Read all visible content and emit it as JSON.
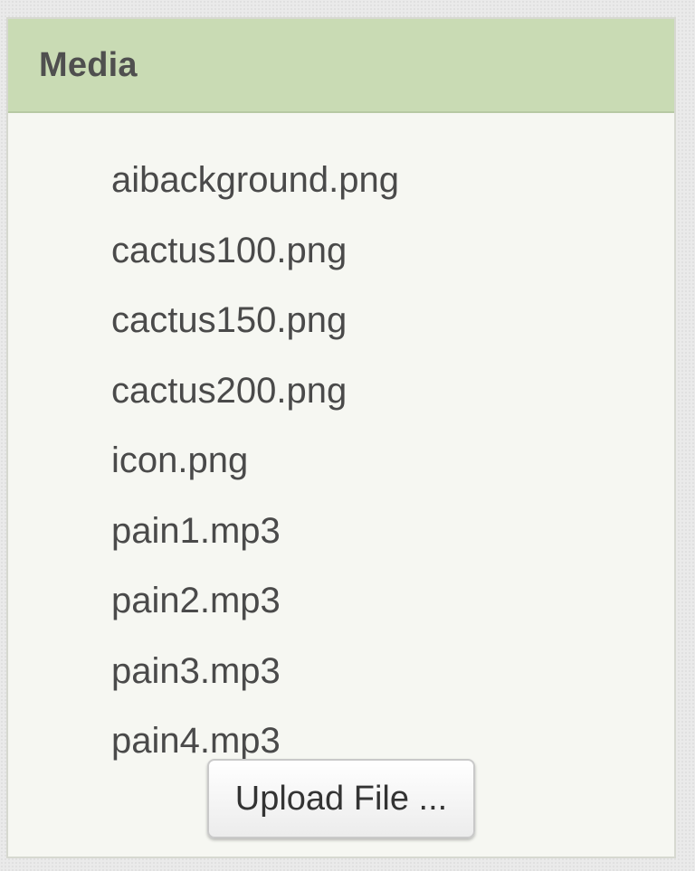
{
  "panel": {
    "title": "Media",
    "colors": {
      "header_bg": "#c9dbb4",
      "body_bg": "#f6f7f2"
    }
  },
  "media": {
    "files": [
      "aibackground.png",
      "cactus100.png",
      "cactus150.png",
      "cactus200.png",
      "icon.png",
      "pain1.mp3",
      "pain2.mp3",
      "pain3.mp3",
      "pain4.mp3"
    ],
    "upload_label": "Upload File ..."
  }
}
